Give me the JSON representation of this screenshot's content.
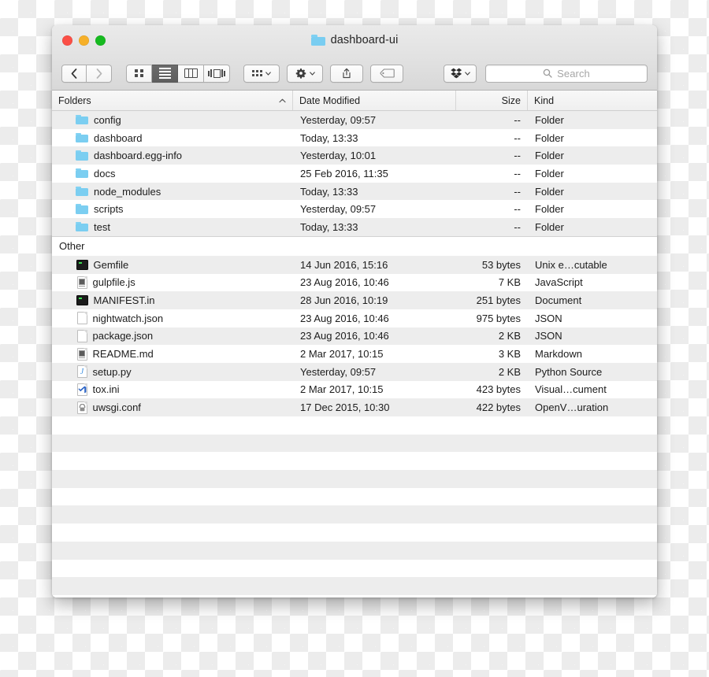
{
  "window": {
    "title": "dashboard-ui",
    "title_icon": "folder-icon",
    "traffic_lights": [
      {
        "name": "close-button",
        "color": "#fb4f46"
      },
      {
        "name": "minimize-button",
        "color": "#f6b029"
      },
      {
        "name": "zoom-button",
        "color": "#16ba20"
      }
    ]
  },
  "toolbar": {
    "back_icon": "chevron-left-icon",
    "forward_icon": "chevron-right-icon",
    "view_modes": [
      {
        "name": "icon-view",
        "icon": "grid-icon",
        "active": false
      },
      {
        "name": "list-view",
        "icon": "list-icon",
        "active": true
      },
      {
        "name": "column-view",
        "icon": "columns-icon",
        "active": false
      },
      {
        "name": "coverflow-view",
        "icon": "coverflow-icon",
        "active": false
      }
    ],
    "arrange_icon": "arrange-grid-icon",
    "action_icon": "gear-icon",
    "share_icon": "share-icon",
    "tag_icon": "tag-icon",
    "dropbox_icon": "dropbox-icon",
    "chevron_icon": "chevron-down-icon"
  },
  "search": {
    "placeholder": "Search",
    "value": "",
    "icon": "search-icon"
  },
  "columns": [
    {
      "label": "Folders",
      "sorted": true,
      "sort_direction": "ascending"
    },
    {
      "label": "Date Modified",
      "sorted": false
    },
    {
      "label": "Size",
      "sorted": false
    },
    {
      "label": "Kind",
      "sorted": false
    }
  ],
  "groups": [
    {
      "label": null,
      "rows": [
        {
          "icon": "folder-icon",
          "name": "config",
          "date": "Yesterday, 09:57",
          "size": "--",
          "kind": "Folder"
        },
        {
          "icon": "folder-icon",
          "name": "dashboard",
          "date": "Today, 13:33",
          "size": "--",
          "kind": "Folder"
        },
        {
          "icon": "folder-icon",
          "name": "dashboard.egg-info",
          "date": "Yesterday, 10:01",
          "size": "--",
          "kind": "Folder"
        },
        {
          "icon": "folder-icon",
          "name": "docs",
          "date": "25 Feb 2016, 11:35",
          "size": "--",
          "kind": "Folder"
        },
        {
          "icon": "folder-icon",
          "name": "node_modules",
          "date": "Today, 13:33",
          "size": "--",
          "kind": "Folder"
        },
        {
          "icon": "folder-icon",
          "name": "scripts",
          "date": "Yesterday, 09:57",
          "size": "--",
          "kind": "Folder"
        },
        {
          "icon": "folder-icon",
          "name": "test",
          "date": "Today, 13:33",
          "size": "--",
          "kind": "Folder"
        }
      ]
    },
    {
      "label": "Other",
      "rows": [
        {
          "icon": "terminal-file-icon",
          "name": "Gemfile",
          "date": "14 Jun 2016, 15:16",
          "size": "53 bytes",
          "kind": "Unix e…cutable"
        },
        {
          "icon": "document-file-icon",
          "name": "gulpfile.js",
          "date": "23 Aug 2016, 10:46",
          "size": "7 KB",
          "kind": "JavaScript"
        },
        {
          "icon": "terminal-file-icon",
          "name": "MANIFEST.in",
          "date": "28 Jun 2016, 10:19",
          "size": "251 bytes",
          "kind": "Document"
        },
        {
          "icon": "blank-file-icon",
          "name": "nightwatch.json",
          "date": "23 Aug 2016, 10:46",
          "size": "975 bytes",
          "kind": "JSON"
        },
        {
          "icon": "blank-file-icon",
          "name": "package.json",
          "date": "23 Aug 2016, 10:46",
          "size": "2 KB",
          "kind": "JSON"
        },
        {
          "icon": "document-file-icon",
          "name": "README.md",
          "date": "2 Mar 2017, 10:15",
          "size": "3 KB",
          "kind": "Markdown"
        },
        {
          "icon": "python-file-icon",
          "name": "setup.py",
          "date": "Yesterday, 09:57",
          "size": "2 KB",
          "kind": "Python Source"
        },
        {
          "icon": "vs-file-icon",
          "name": "tox.ini",
          "date": "2 Mar 2017, 10:15",
          "size": "423 bytes",
          "kind": "Visual…cument"
        },
        {
          "icon": "openvpn-file-icon",
          "name": "uwsgi.conf",
          "date": "17 Dec 2015, 10:30",
          "size": "422 bytes",
          "kind": "OpenV…uration"
        }
      ]
    }
  ],
  "colors": {
    "folder_blue": "#7bcef1",
    "row_stripe": "#ededec",
    "toolbar_bg": "#ddddddd",
    "selected_segment": "#646464"
  }
}
